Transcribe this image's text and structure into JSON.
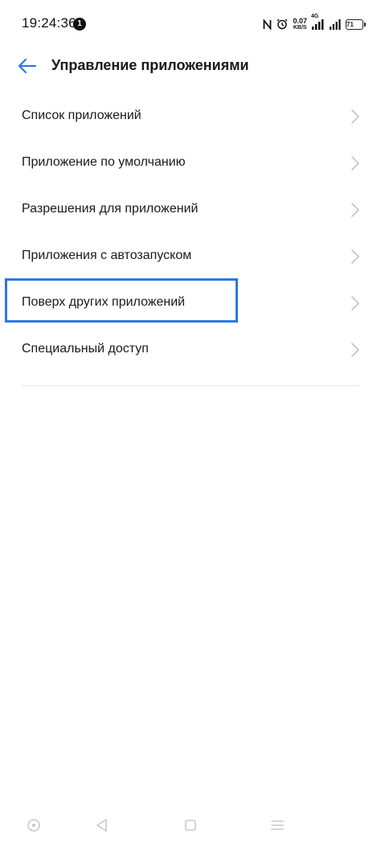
{
  "status_bar": {
    "time": "19:24:36",
    "notification_count": "1",
    "net_speed_value": "0.07",
    "net_speed_unit": "KB/S",
    "network_type": "4G",
    "battery": "71"
  },
  "header": {
    "title": "Управление приложениями",
    "back_icon": "arrow-left-icon"
  },
  "menu": {
    "items": [
      {
        "label": "Список приложений"
      },
      {
        "label": "Приложение по умолчанию"
      },
      {
        "label": "Разрешения для приложений"
      },
      {
        "label": "Приложения с автозапуском"
      },
      {
        "label": "Поверх других приложений",
        "highlighted": true
      },
      {
        "label": "Специальный доступ"
      }
    ]
  },
  "colors": {
    "accent": "#2b78e4",
    "highlight_border": "#2b78e4",
    "text": "#1a1a1a",
    "chevron": "#c4c4c4",
    "nav_icons": "#c8c8c8"
  },
  "nav_bar": {
    "icons": [
      "assistant-circle-icon",
      "back-triangle-icon",
      "home-square-icon",
      "menu-lines-icon"
    ]
  }
}
